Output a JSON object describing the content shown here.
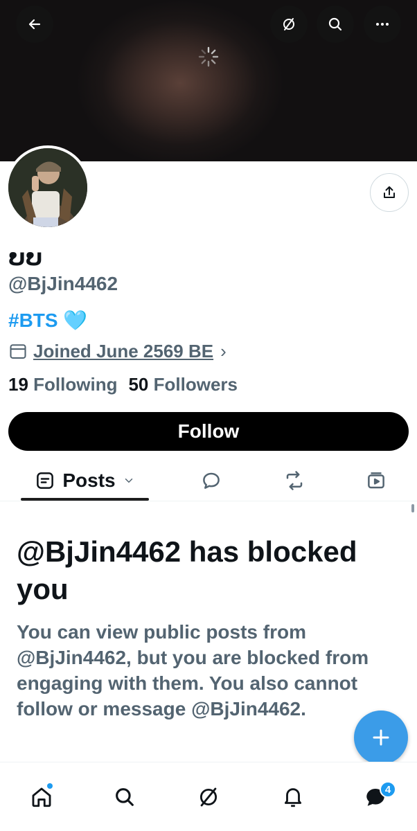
{
  "header": {
    "back_icon": "arrow-left-icon",
    "grok_icon": "grok-icon",
    "search_icon": "search-icon",
    "more_icon": "more-horizontal-icon"
  },
  "profile": {
    "display_name": "ບບ",
    "handle": "@BjJin4462",
    "bio_hashtag": "#BTS",
    "bio_emoji": "🩵",
    "joined": "Joined June 2569 BE",
    "following_count": "19",
    "following_label": "Following",
    "followers_count": "50",
    "followers_label": "Followers",
    "follow_button": "Follow"
  },
  "tabs": {
    "posts_label": "Posts"
  },
  "blocked": {
    "title": "@BjJin4462 has blocked you",
    "body": "You can view public posts from @BjJin4462, but you are blocked from engaging with them. You also cannot follow or message @BjJin4462."
  },
  "bottom_nav": {
    "messages_badge": "4"
  },
  "colors": {
    "accent": "#1d9bf0",
    "fab": "#3b9ce8",
    "text_secondary": "#536471"
  }
}
